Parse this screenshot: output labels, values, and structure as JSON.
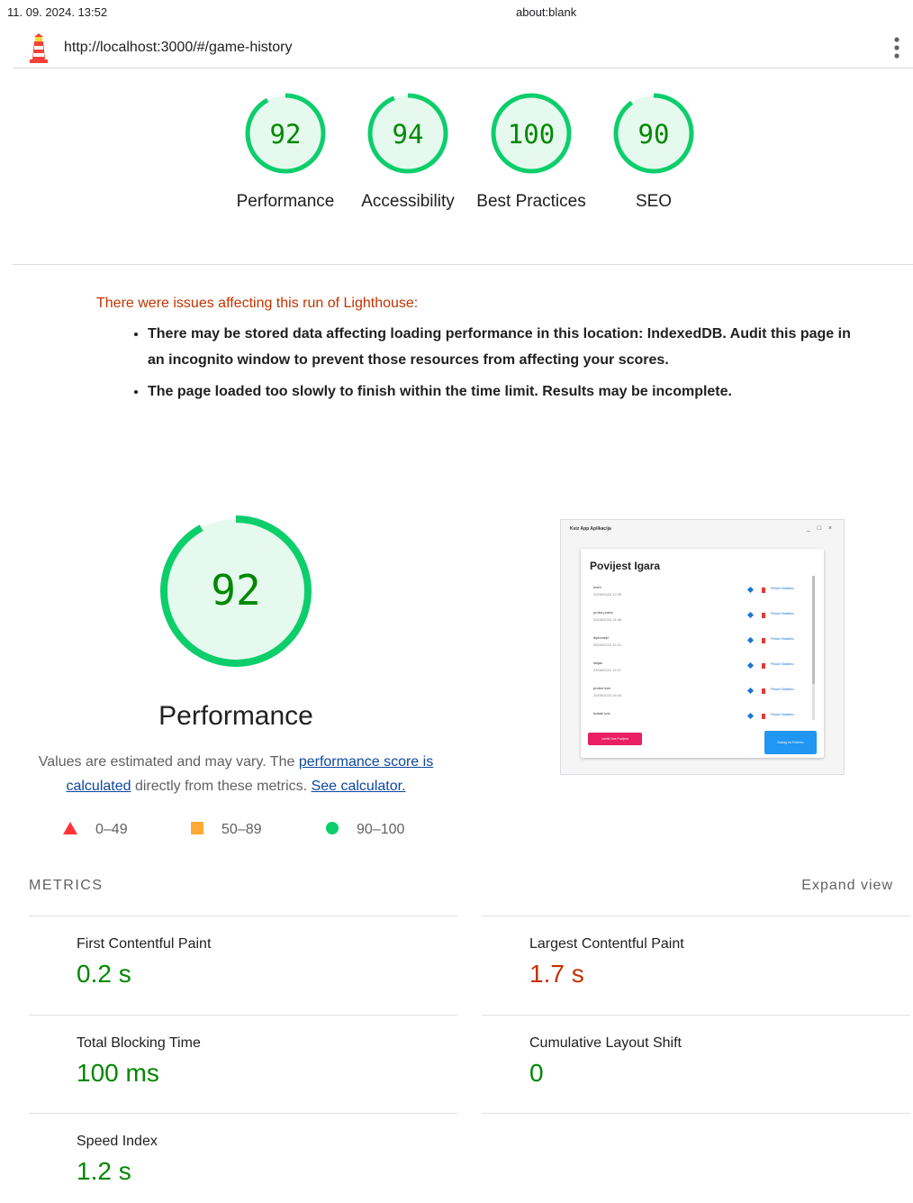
{
  "print_header": {
    "date": "11. 09. 2024. 13:52",
    "title": "about:blank"
  },
  "topbar": {
    "url": "http://localhost:3000/#/game-history",
    "logo_icon": "lighthouse-icon",
    "menu_icon": "kebab-menu-icon"
  },
  "gauges": [
    {
      "score": "92",
      "label": "Performance",
      "fraction": 0.92
    },
    {
      "score": "94",
      "label": "Accessibility",
      "fraction": 0.94
    },
    {
      "score": "100",
      "label": "Best Practices",
      "fraction": 1.0
    },
    {
      "score": "90",
      "label": "SEO",
      "fraction": 0.9
    }
  ],
  "colors": {
    "pass": "#0cce6b",
    "pass_bg": "#e6f9ee",
    "pass_text": "#008800",
    "average": "#ffa400",
    "fail": "#ff3333",
    "warning_text": "#c33300",
    "link": "#0d47a1"
  },
  "warnings": {
    "heading": "There were issues affecting this run of Lighthouse:",
    "items": [
      "There may be stored data affecting loading performance in this location: IndexedDB. Audit this page in an incognito window to prevent those resources from affecting your scores.",
      "The page loaded too slowly to finish within the time limit. Results may be incomplete."
    ]
  },
  "performance": {
    "score": "92",
    "fraction": 0.92,
    "title": "Performance",
    "desc_pre": "Values are estimated and may vary. The ",
    "desc_link1": "performance score is calculated",
    "desc_mid": " directly from these metrics. ",
    "desc_link2": "See calculator."
  },
  "legend": {
    "fail": "0–49",
    "average": "50–89",
    "pass": "90–100"
  },
  "screenshot": {
    "window_title": "Kviz App Aplikacija",
    "window_controls": "_ □ ×",
    "panel_title": "Povijest Igara",
    "rows": [
      {
        "name": "kviz1",
        "date": "20/08/2024 12:39"
      },
      {
        "name": "proba proba",
        "date": "20/08/2024 14:48"
      },
      {
        "name": "diplomski",
        "date": "06/09/2024 15:21"
      },
      {
        "name": "skijas",
        "date": "22/08/2024 11:57"
      },
      {
        "name": "probni kviz",
        "date": "20/08/2024 16:44"
      },
      {
        "name": "kratak kviz",
        "date": ""
      }
    ],
    "row_action": "Prikaži Statistiku",
    "delete_button": "Izbriši Sve Povijest",
    "back_button": "Natrag na Početnu"
  },
  "metrics": {
    "heading": "METRICS",
    "expand": "Expand view",
    "items": [
      {
        "name": "First Contentful Paint",
        "value": "0.2 s",
        "rating": "pass"
      },
      {
        "name": "Largest Contentful Paint",
        "value": "1.7 s",
        "rating": "average"
      },
      {
        "name": "Total Blocking Time",
        "value": "100 ms",
        "rating": "pass"
      },
      {
        "name": "Cumulative Layout Shift",
        "value": "0",
        "rating": "pass"
      },
      {
        "name": "Speed Index",
        "value": "1.2 s",
        "rating": "pass"
      }
    ]
  }
}
